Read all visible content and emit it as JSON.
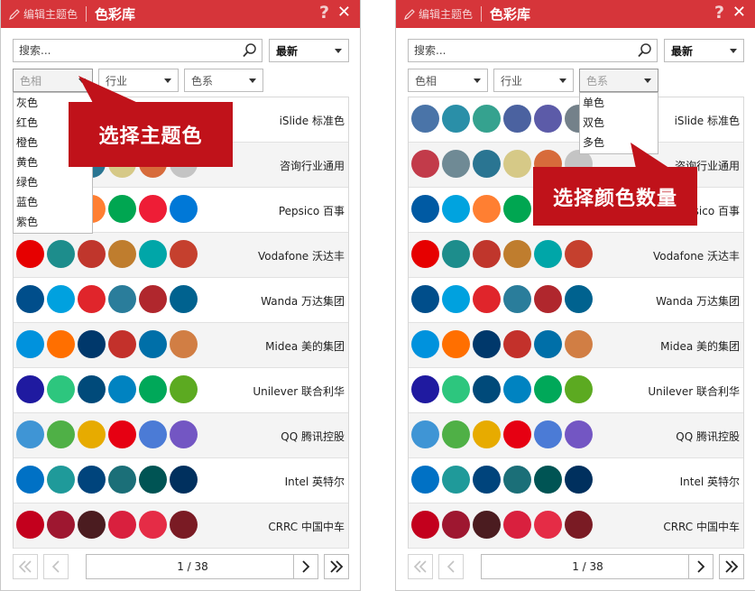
{
  "panels": [
    {
      "id": "left",
      "title": "色彩库",
      "edit_theme": "编辑主题色",
      "help": "?",
      "close": "✕",
      "search_placeholder": "搜索...",
      "sort": "最新",
      "filters": [
        "色相",
        "行业",
        "色系"
      ],
      "active_filter": 0,
      "dropdown_options": [
        "灰色",
        "红色",
        "橙色",
        "黄色",
        "绿色",
        "蓝色",
        "紫色"
      ],
      "callout": "选择主题色",
      "page": "1 / 38",
      "rows": [
        {
          "label": "iSlide 标准色",
          "colors": [
            "#4a74a8",
            "#2a8fa8",
            "#35a28f",
            "#4b62a0",
            "#5c5ba8",
            "#74818a"
          ]
        },
        {
          "label": "咨询行业通用",
          "colors": [
            "#c23b4a",
            "#6f8a95",
            "#2a7592",
            "#d6c987",
            "#d76b3b",
            "#c4c4c4"
          ]
        },
        {
          "label": "Pepsico 百事",
          "colors": [
            "#005aa3",
            "#00a3df",
            "#ff7f32",
            "#00a651",
            "#ee1d36",
            "#0078d7"
          ]
        },
        {
          "label": "Vodafone 沃达丰",
          "colors": [
            "#e60000",
            "#1d8d8c",
            "#c0362c",
            "#bf7d2e",
            "#00a6a8",
            "#c5402e"
          ]
        },
        {
          "label": "Wanda 万达集团",
          "colors": [
            "#004e8b",
            "#00a1df",
            "#e0252b",
            "#2a7d9b",
            "#b0272d",
            "#00628f"
          ]
        },
        {
          "label": "Midea 美的集团",
          "colors": [
            "#0092dd",
            "#ff6f00",
            "#00386b",
            "#c3312b",
            "#006fa8",
            "#d17e44"
          ]
        },
        {
          "label": "Unilever 联合利华",
          "colors": [
            "#1f1aa0",
            "#2dc67e",
            "#004a7a",
            "#0083c1",
            "#00a859",
            "#5caa21"
          ]
        },
        {
          "label": "QQ 腾讯控股",
          "colors": [
            "#3f95d5",
            "#4fb046",
            "#e7ab00",
            "#e60012",
            "#4b7bd6",
            "#7356c3"
          ]
        },
        {
          "label": "Intel 英特尔",
          "colors": [
            "#0071c5",
            "#1f9a9a",
            "#00447c",
            "#1b6f78",
            "#005454",
            "#00305e"
          ]
        },
        {
          "label": "CRRC 中国中车",
          "colors": [
            "#c3001d",
            "#9e1730",
            "#4b1c20",
            "#d9203e",
            "#e52c46",
            "#7a1b24"
          ]
        }
      ]
    },
    {
      "id": "right",
      "title": "色彩库",
      "edit_theme": "编辑主题色",
      "help": "?",
      "close": "✕",
      "search_placeholder": "搜索...",
      "sort": "最新",
      "filters": [
        "色相",
        "行业",
        "色系"
      ],
      "active_filter": 2,
      "dropdown_options": [
        "单色",
        "双色",
        "多色"
      ],
      "callout": "选择颜色数量",
      "page": "1 / 38",
      "rows": [
        {
          "label": "iSlide 标准色",
          "colors": [
            "#4a74a8",
            "#2a8fa8",
            "#35a28f",
            "#4b62a0",
            "#5c5ba8",
            "#74818a"
          ]
        },
        {
          "label": "咨询行业通用",
          "colors": [
            "#c23b4a",
            "#6f8a95",
            "#2a7592",
            "#d6c987",
            "#d76b3b",
            "#c4c4c4"
          ]
        },
        {
          "label": "Pepsico 百事",
          "colors": [
            "#005aa3",
            "#00a3df",
            "#ff7f32",
            "#00a651",
            "#ee1d36",
            "#0078d7"
          ]
        },
        {
          "label": "Vodafone 沃达丰",
          "colors": [
            "#e60000",
            "#1d8d8c",
            "#c0362c",
            "#bf7d2e",
            "#00a6a8",
            "#c5402e"
          ]
        },
        {
          "label": "Wanda 万达集团",
          "colors": [
            "#004e8b",
            "#00a1df",
            "#e0252b",
            "#2a7d9b",
            "#b0272d",
            "#00628f"
          ]
        },
        {
          "label": "Midea 美的集团",
          "colors": [
            "#0092dd",
            "#ff6f00",
            "#00386b",
            "#c3312b",
            "#006fa8",
            "#d17e44"
          ]
        },
        {
          "label": "Unilever 联合利华",
          "colors": [
            "#1f1aa0",
            "#2dc67e",
            "#004a7a",
            "#0083c1",
            "#00a859",
            "#5caa21"
          ]
        },
        {
          "label": "QQ 腾讯控股",
          "colors": [
            "#3f95d5",
            "#4fb046",
            "#e7ab00",
            "#e60012",
            "#4b7bd6",
            "#7356c3"
          ]
        },
        {
          "label": "Intel 英特尔",
          "colors": [
            "#0071c5",
            "#1f9a9a",
            "#00447c",
            "#1b6f78",
            "#005454",
            "#00305e"
          ]
        },
        {
          "label": "CRRC 中国中车",
          "colors": [
            "#c3001d",
            "#9e1730",
            "#4b1c20",
            "#d9203e",
            "#e52c46",
            "#7a1b24"
          ]
        }
      ]
    }
  ],
  "colors": {
    "titlebar": "#d6353a",
    "callout": "#c0121a"
  }
}
